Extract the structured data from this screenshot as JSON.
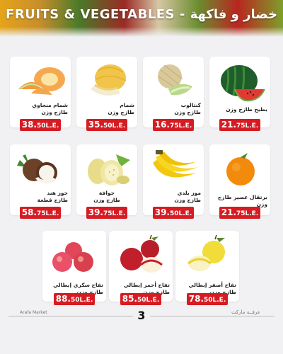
{
  "header": {
    "title": "FRUITS & VEGETABLES - خضار و فاكهة"
  },
  "products": [
    {
      "name": "شمام منجاوي\nطازج وزن",
      "price": "38.",
      "cents": "50",
      "unit": "L.E."
    },
    {
      "name": "شمام\nطازج وزن",
      "price": "35.",
      "cents": "50",
      "unit": "L.E."
    },
    {
      "name": "كنتالوب\nطازج وزن",
      "price": "16.",
      "cents": "75",
      "unit": "L.E."
    },
    {
      "name": "بطيخ طازج وزن",
      "price": "21.",
      "cents": "75",
      "unit": "L.E."
    },
    {
      "name": "جوز هند\nطازج قطعة",
      "price": "58.",
      "cents": "75",
      "unit": "L.E."
    },
    {
      "name": "جوافة\nطازج وزن",
      "price": "39.",
      "cents": "75",
      "unit": "L.E."
    },
    {
      "name": "موز بلدي\nطازج وزن",
      "price": "39.",
      "cents": "50",
      "unit": "L.E."
    },
    {
      "name": "برتقال عصير طازج وزن",
      "price": "21.",
      "cents": "75",
      "unit": "L.E."
    },
    {
      "name": "تفاح سكري إيطالي طازج وزن",
      "price": "88.",
      "cents": "50",
      "unit": "L.E."
    },
    {
      "name": "تفاح أحمر إيطالي طازج وزن",
      "price": "85.",
      "cents": "50",
      "unit": "L.E."
    },
    {
      "name": "تفاح أصفر إيطالي طازج وزن",
      "price": "78.",
      "cents": "50",
      "unit": "L.E."
    }
  ],
  "footer": {
    "brand_en": "Arafa Market",
    "brand_ar": "عرفــة ماركت",
    "page": "3"
  },
  "colors": {
    "price_tag": "#d61c22",
    "background": "#f1f1f3"
  }
}
